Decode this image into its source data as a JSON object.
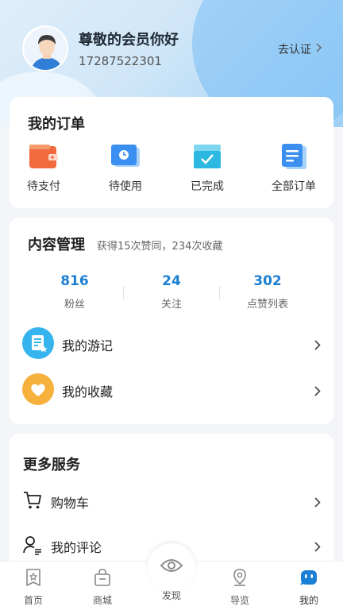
{
  "profile": {
    "greeting": "尊敬的会员你好",
    "phone": "17287522301",
    "verify_label": "去认证"
  },
  "orders": {
    "title": "我的订单",
    "items": [
      {
        "label": "待支付",
        "icon": "wallet-icon"
      },
      {
        "label": "待使用",
        "icon": "clock-card-icon"
      },
      {
        "label": "已完成",
        "icon": "check-box-icon"
      },
      {
        "label": "全部订单",
        "icon": "list-doc-icon"
      }
    ]
  },
  "content": {
    "title": "内容管理",
    "subtitle": "获得15次赞同，234次收藏",
    "stats": [
      {
        "value": "816",
        "label": "粉丝"
      },
      {
        "value": "24",
        "label": "关注"
      },
      {
        "value": "302",
        "label": "点赞列表"
      }
    ],
    "rows": [
      {
        "label": "我的游记",
        "icon": "travel-note-icon"
      },
      {
        "label": "我的收藏",
        "icon": "heart-icon"
      }
    ]
  },
  "services": {
    "title": "更多服务",
    "rows": [
      {
        "label": "购物车",
        "icon": "cart-icon"
      },
      {
        "label": "我的评论",
        "icon": "user-comment-icon"
      }
    ]
  },
  "tabbar": {
    "items": [
      {
        "label": "首页",
        "icon": "home-icon"
      },
      {
        "label": "商城",
        "icon": "shop-bag-icon"
      },
      {
        "label": "发现",
        "icon": "eye-icon"
      },
      {
        "label": "导览",
        "icon": "map-pin-icon"
      },
      {
        "label": "我的",
        "icon": "robot-icon"
      }
    ],
    "active": "我的"
  },
  "colors": {
    "accent_blue": "#1b7fd4",
    "order_orange": "#f26a3d",
    "order_blue": "#3a8ff0",
    "order_teal": "#2cb8e0"
  }
}
